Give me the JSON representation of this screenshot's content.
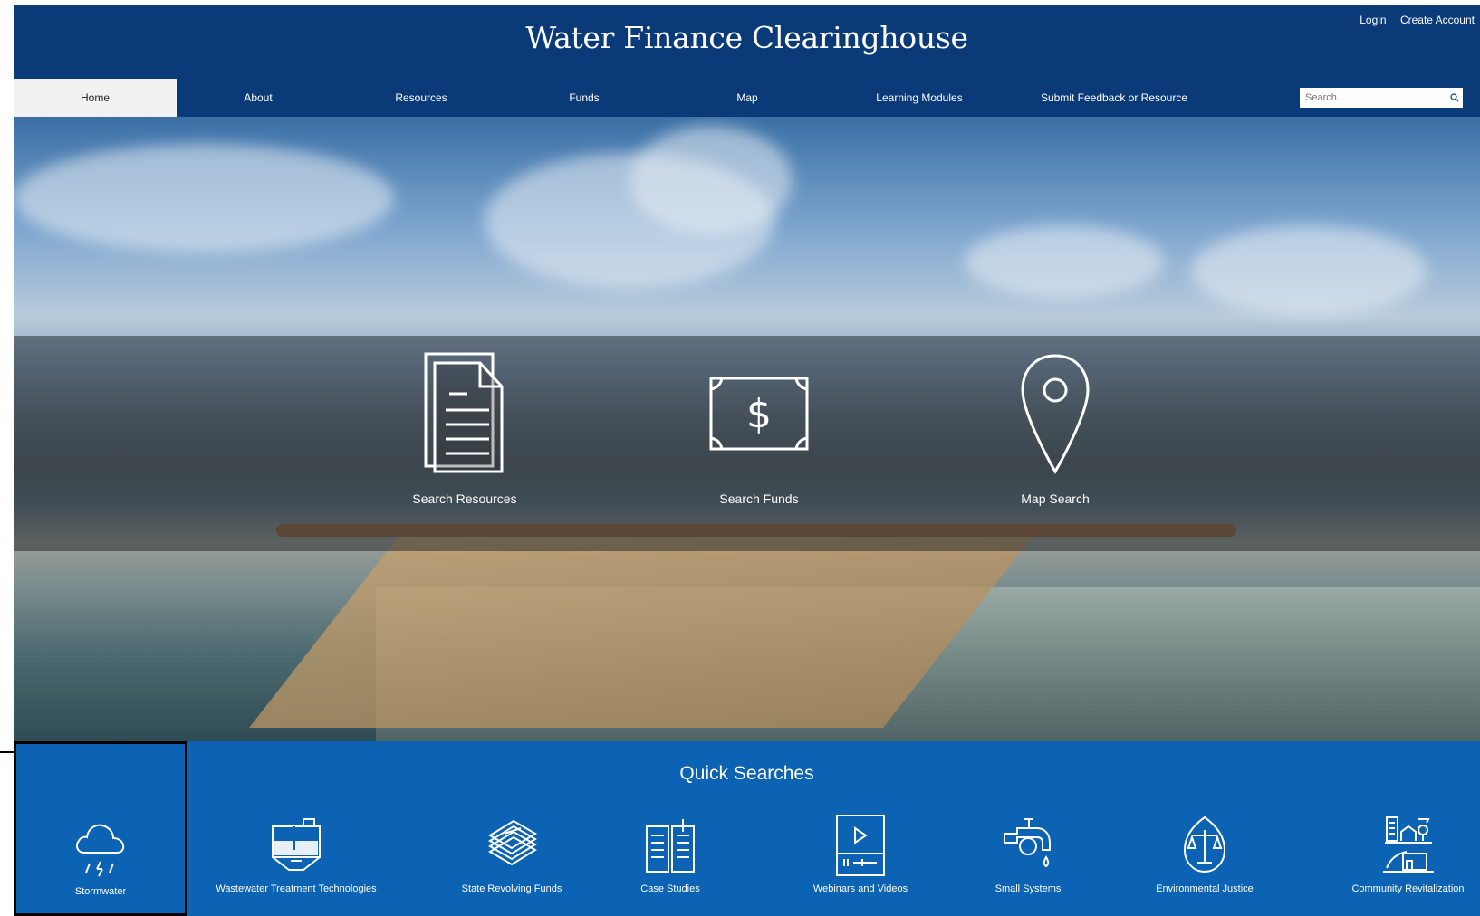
{
  "header": {
    "title": "Water Finance Clearinghouse",
    "login": "Login",
    "create_account": "Create Account"
  },
  "nav": {
    "items": [
      {
        "label": "Home",
        "active": true
      },
      {
        "label": "About"
      },
      {
        "label": "Resources"
      },
      {
        "label": "Funds"
      },
      {
        "label": "Map"
      },
      {
        "label": "Learning Modules"
      },
      {
        "label": "Submit Feedback or Resource"
      }
    ],
    "search_placeholder": "Search..."
  },
  "hero": {
    "actions": [
      {
        "label": "Search Resources",
        "icon": "document-icon"
      },
      {
        "label": "Search Funds",
        "icon": "dollar-bill-icon"
      },
      {
        "label": "Map Search",
        "icon": "map-pin-icon"
      }
    ]
  },
  "quick_searches": {
    "title": "Quick Searches",
    "items": [
      {
        "label": "Stormwater",
        "icon": "rain-cloud-icon",
        "selected": true
      },
      {
        "label": "Wastewater Treatment Technologies",
        "icon": "treatment-tank-icon"
      },
      {
        "label": "State Revolving Funds",
        "icon": "money-stack-icon"
      },
      {
        "label": "Case Studies",
        "icon": "open-book-icon"
      },
      {
        "label": "Webinars and Videos",
        "icon": "video-player-icon"
      },
      {
        "label": "Small Systems",
        "icon": "faucet-icon"
      },
      {
        "label": "Environmental Justice",
        "icon": "scales-icon"
      },
      {
        "label": "Community Revitalization",
        "icon": "community-icon"
      }
    ]
  },
  "colors": {
    "header_bg": "#0a3a78",
    "quick_bg": "#0c62b3"
  }
}
